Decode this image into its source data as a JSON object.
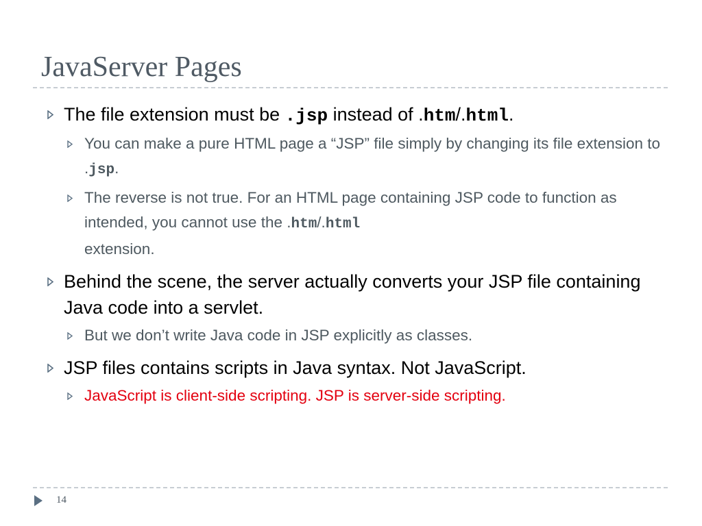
{
  "slide": {
    "title": "JavaServer Pages",
    "page_number": "14",
    "colors": {
      "title": "#4f5a64",
      "bullet_arrow": "#5a6f82",
      "sub_text": "#4e5960",
      "highlight_red": "#e3000f",
      "divider": "#c7cdd3"
    },
    "icons": {
      "bullet": "triangle-right-outline-icon",
      "footer": "triangle-right-filled-icon"
    }
  },
  "bullets": [
    {
      "parts": [
        "The file extension must be ",
        ".jsp",
        " instead of .",
        "htm",
        "/.",
        "html",
        "."
      ],
      "subs": [
        {
          "parts": [
            "You can make a pure HTML page a “JSP” file simply by changing its file extension to .",
            "jsp",
            "."
          ]
        },
        {
          "parts": [
            "The reverse is not true.  For an HTML page containing JSP code to function as intended, you cannot use the .",
            "htm",
            "/.",
            "html",
            " extension."
          ]
        }
      ]
    },
    {
      "text": "Behind the scene, the server actually converts your JSP file containing Java code into a servlet.",
      "subs": [
        {
          "text": "But we don’t write Java code in JSP explicitly as classes."
        }
      ]
    },
    {
      "text": "JSP files contains scripts in Java syntax. Not JavaScript.",
      "subs": [
        {
          "text": "JavaScript is client-side scripting.  JSP is server-side scripting."
        }
      ]
    }
  ]
}
